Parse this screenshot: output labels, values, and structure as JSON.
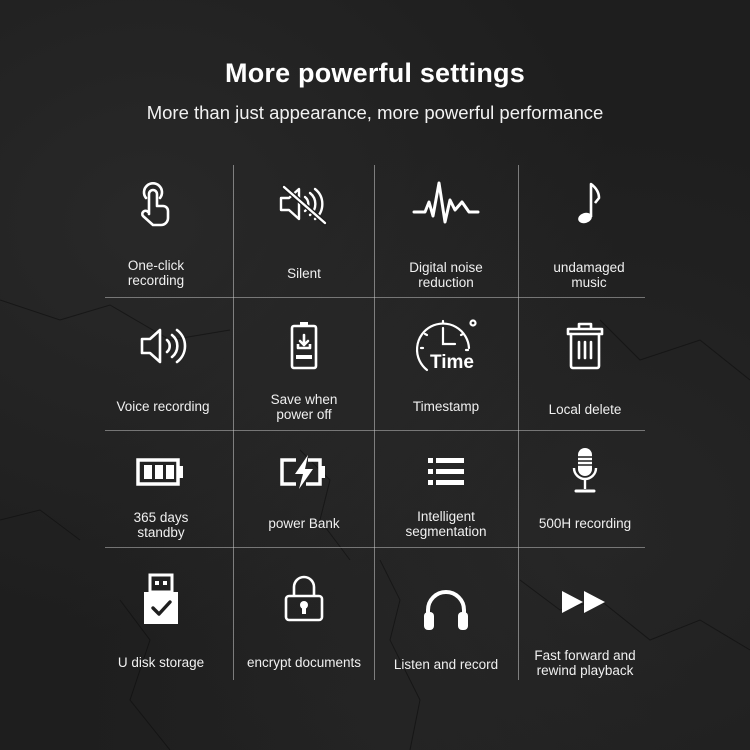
{
  "header": {
    "title": "More powerful settings",
    "subtitle": "More than just appearance, more powerful performance"
  },
  "features": [
    {
      "label": "One-click\nrecording",
      "icon": "touch-icon"
    },
    {
      "label": "Silent",
      "icon": "mute-icon"
    },
    {
      "label": "Digital noise\nreduction",
      "icon": "waveform-icon"
    },
    {
      "label": "undamaged\nmusic",
      "icon": "music-note-icon"
    },
    {
      "label": "Voice recording",
      "icon": "speaker-icon"
    },
    {
      "label": "Save when\npower off",
      "icon": "battery-save-icon"
    },
    {
      "label": "Timestamp",
      "icon": "clock-time-icon"
    },
    {
      "label": "Local delete",
      "icon": "trash-icon"
    },
    {
      "label": "365 days\nstandby",
      "icon": "battery-full-icon"
    },
    {
      "label": "power Bank",
      "icon": "battery-charge-icon"
    },
    {
      "label": "Intelligent\nsegmentation",
      "icon": "list-icon"
    },
    {
      "label": "500H recording",
      "icon": "microphone-icon"
    },
    {
      "label": "U disk storage",
      "icon": "usb-check-icon"
    },
    {
      "label": "encrypt documents",
      "icon": "padlock-icon"
    },
    {
      "label": "Listen and record",
      "icon": "headphones-icon"
    },
    {
      "label": "Fast forward and\nrewind playback",
      "icon": "fast-forward-icon"
    }
  ],
  "colors": {
    "background": "#1e1e1e",
    "text": "#ffffff",
    "grid_line": "#c8c8c8"
  }
}
